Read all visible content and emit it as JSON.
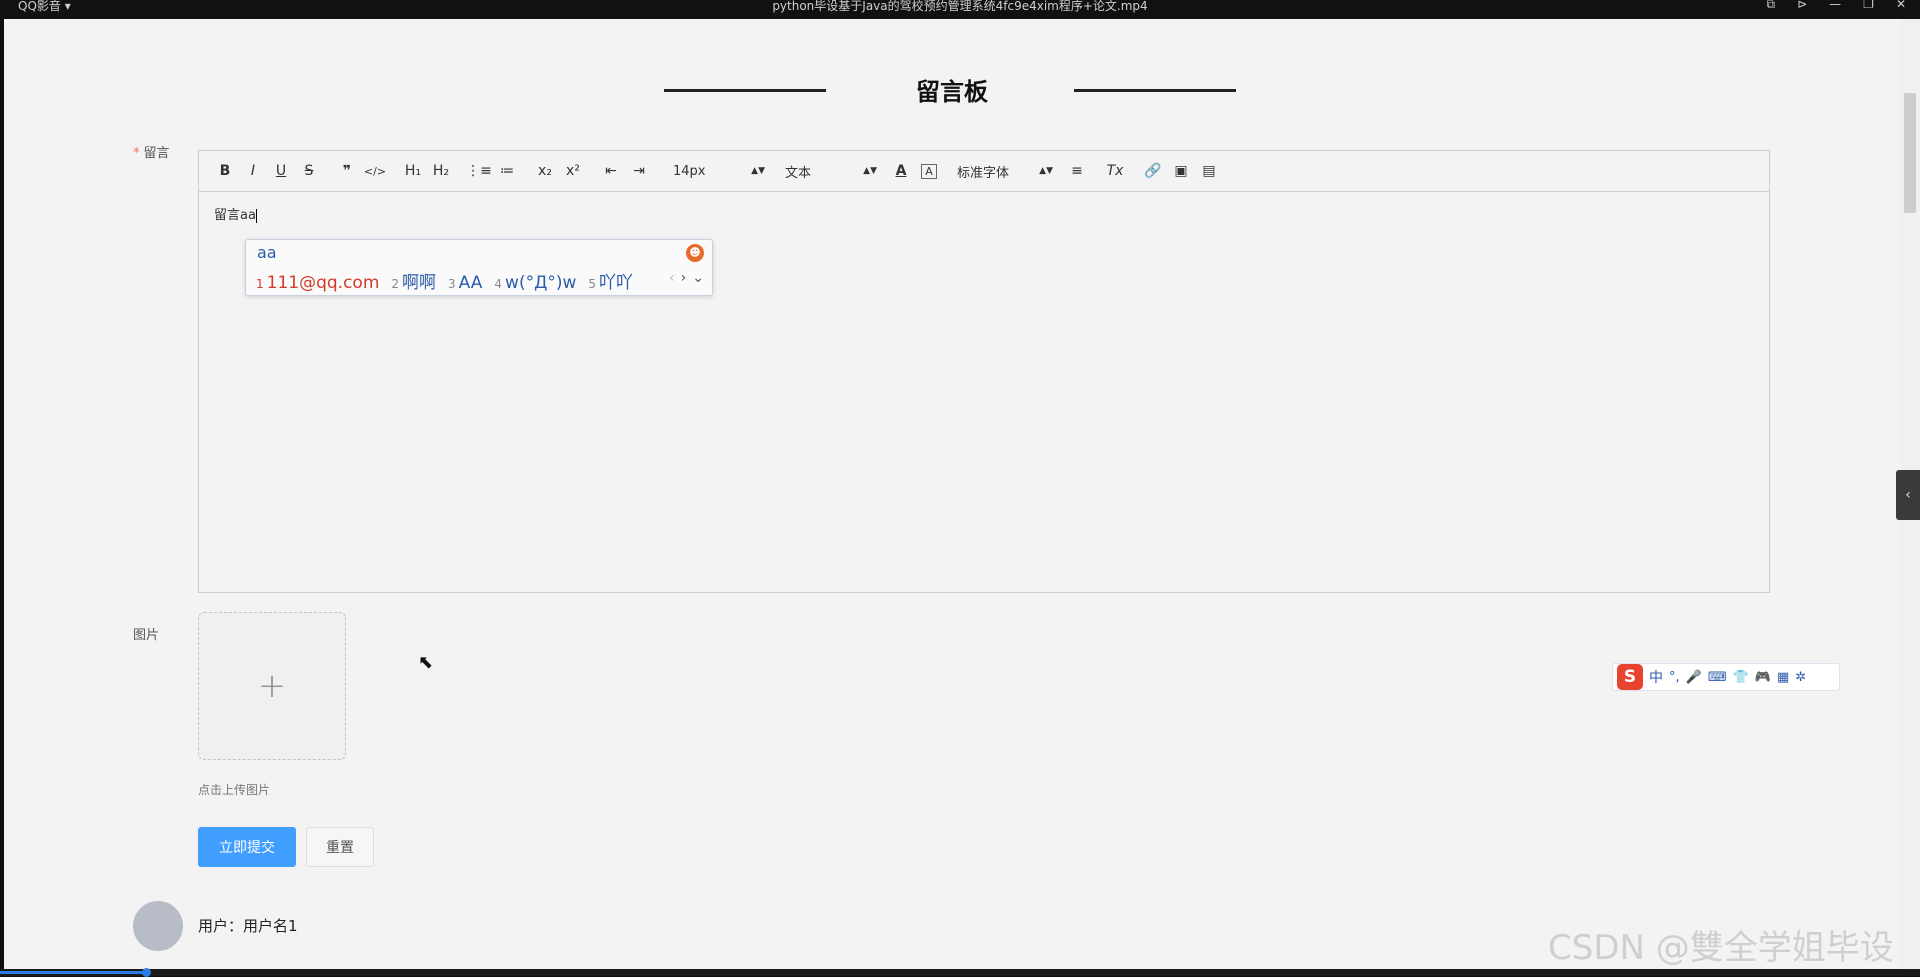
{
  "player": {
    "app_name": "QQ影音 ▾",
    "file_title": "python毕设基于Java的驾校预约管理系统4fc9e4xim程序+论文.mp4",
    "window_controls": [
      "⧉",
      "⊳",
      "—",
      "❐",
      "✕"
    ],
    "progress": 0.076
  },
  "page": {
    "title": "留言板"
  },
  "form": {
    "message_label": "留言",
    "required_mark": "*",
    "toolbar": {
      "bold": "B",
      "italic": "I",
      "underline": "U",
      "strike": "S",
      "blockquote": "❞",
      "code": "</>",
      "h1": "H₁",
      "h2": "H₂",
      "ordered_list": "⋮≡",
      "bullet_list": "≔",
      "subscript": "x₂",
      "superscript": "x²",
      "outdent": "⇤",
      "indent": "⇥",
      "font_size": "14px",
      "heading_select": "文本",
      "text_color": "A",
      "bg_color": "A",
      "font_family": "标准字体",
      "align": "≡",
      "clear_format": "Tx",
      "link": "🔗",
      "image": "▣",
      "video": "▤"
    },
    "editor_content": "留言aa",
    "image_label": "图片",
    "upload_plus": "+",
    "upload_tip": "点击上传图片",
    "submit_label": "立即提交",
    "reset_label": "重置"
  },
  "ime_popup": {
    "composition": "aa",
    "candidates": [
      {
        "num": "1",
        "text": "111@qq.com"
      },
      {
        "num": "2",
        "text": "啊啊"
      },
      {
        "num": "3",
        "text": "AA"
      },
      {
        "num": "4",
        "text": "w(°Д°)w"
      },
      {
        "num": "5",
        "text": "吖吖"
      }
    ],
    "nav": [
      "‹",
      "›",
      "⌄"
    ]
  },
  "ime_status_bar": {
    "logo": "S",
    "mode": "中",
    "icons": [
      "°,",
      "🎤",
      "⌨",
      "👕",
      "🎮",
      "▦",
      "✲"
    ]
  },
  "comments": [
    {
      "user_label": "用户：用户名1"
    }
  ],
  "watermark": "CSDN @雙全学姐毕设",
  "side_tab_icon": "‹"
}
